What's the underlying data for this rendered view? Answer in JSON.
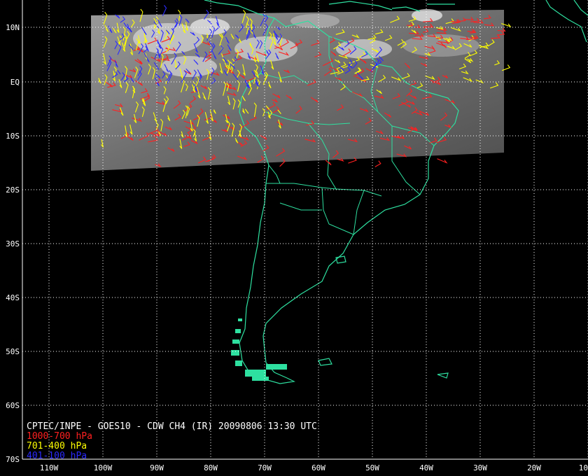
{
  "map": {
    "title": "CPTEC/INPE - GOES10 - CDW CH4 (IR) 20090806 13:30 UTC",
    "lat_labels": [
      "10N",
      "EQ",
      "10S",
      "20S",
      "30S",
      "40S",
      "50S",
      "60S",
      "70S"
    ],
    "lon_labels": [
      "110W",
      "100W",
      "90W",
      "80W",
      "70W",
      "60W",
      "50W",
      "40W",
      "30W",
      "20W",
      "10"
    ],
    "legend": [
      {
        "label": "1000-700 hPa",
        "color": "#ff2020"
      },
      {
        "label": "701-400 hPa",
        "color": "#ffff00"
      },
      {
        "label": "401-100 hPa",
        "color": "#2a2aff"
      }
    ],
    "coastline_color": "#2ee0a0",
    "grid_color": "#ffffff"
  }
}
